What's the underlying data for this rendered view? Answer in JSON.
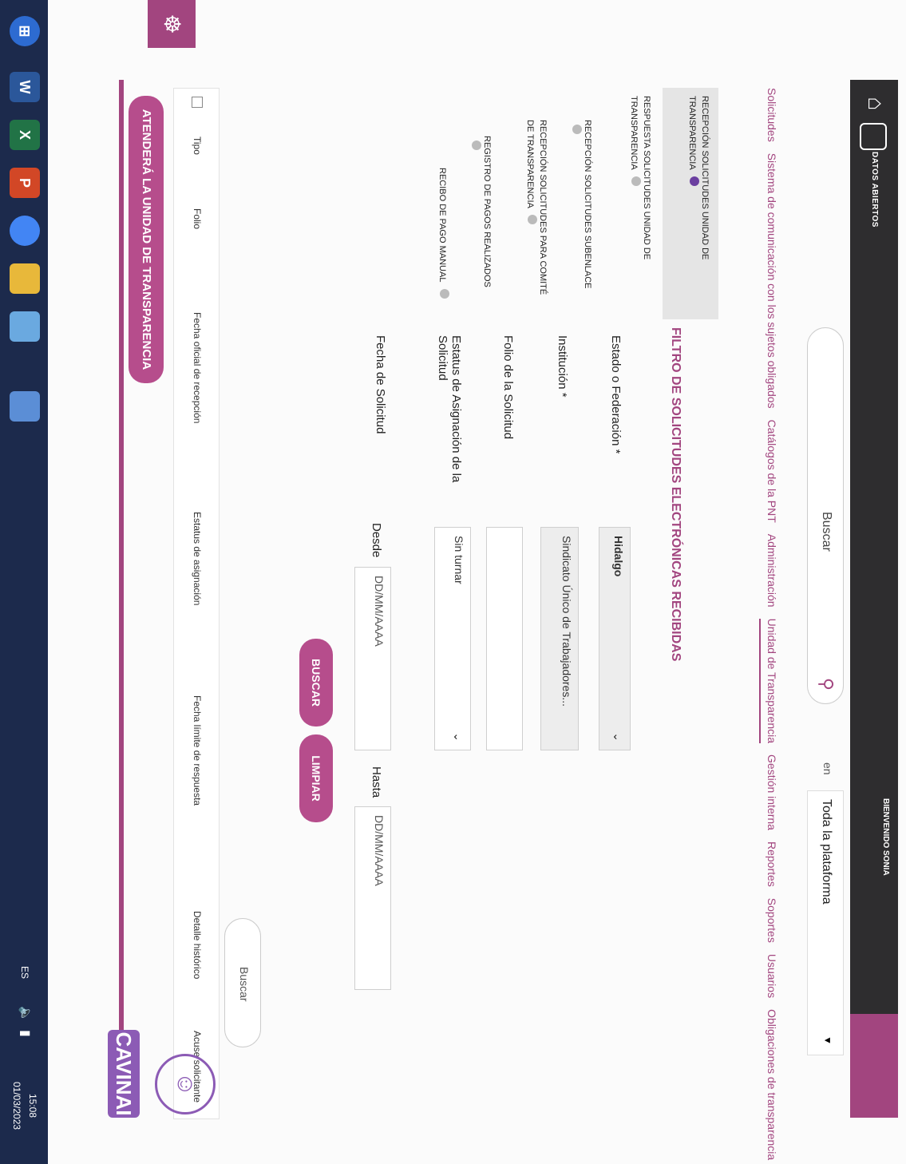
{
  "header": {
    "brand": "DATOS ABIERTOS",
    "search_placeholder": "Buscar",
    "search_in_label": "en",
    "scope_value": "Toda la plataforma",
    "welcome": "BIENVENIDO SONIA"
  },
  "nav": {
    "items": [
      {
        "label": "Solicitudes"
      },
      {
        "label": "Sistema de comunicación con los sujetos obligados"
      },
      {
        "label": "Catálogos de la PNT"
      },
      {
        "label": "Administración"
      },
      {
        "label": "Unidad de Transparencia"
      },
      {
        "label": "Gestión interna"
      },
      {
        "label": "Reportes"
      },
      {
        "label": "Soportes"
      },
      {
        "label": "Usuarios"
      },
      {
        "label": "Obligaciones de transparencia"
      }
    ]
  },
  "sidebar": {
    "items": [
      {
        "label": "RECEPCIÓN SOLICITUDES UNIDAD DE TRANSPARENCIA"
      },
      {
        "label": "RESPUESTA SOLICITUDES UNIDAD DE TRANSPARENCIA"
      },
      {
        "label": "RECEPCIÓN SOLICITUDES SUBENLACE"
      },
      {
        "label": "RECEPCIÓN SOLICITUDES PARA COMITÉ DE TRANSPARENCIA"
      },
      {
        "label": "REGISTRO DE PAGOS REALIZADOS"
      },
      {
        "label": "RECIBO DE PAGO MANUAL"
      }
    ]
  },
  "filter": {
    "title": "FILTRO DE SOLICITUDES ELECTRÓNICAS RECIBIDAS",
    "estado_label": "Estado o Federación *",
    "estado_value": "Hidalgo",
    "institucion_label": "Institución *",
    "institucion_value": "Sindicato Único de Trabajadores...",
    "folio_label": "Folio de la Solicitud",
    "folio_value": "",
    "estatus_label": "Estatus de Asignación de la Solicitud",
    "estatus_value": "Sin turnar",
    "fecha_label": "Fecha de Solicitud",
    "desde_label": "Desde",
    "desde_placeholder": "DD/MM/AAAA",
    "hasta_label": "Hasta",
    "hasta_placeholder": "DD/MM/AAAA",
    "buscar_btn": "BUSCAR",
    "limpiar_btn": "LIMPIAR"
  },
  "table": {
    "search_placeholder": "Buscar",
    "columns": [
      "Tipo",
      "Folio",
      "Fecha oficial de recepción",
      "Estatus de asignación",
      "Fecha límite de respuesta",
      "Detalle histórico",
      "Acuse solicitante"
    ]
  },
  "footer": {
    "attend_btn": "ATENDERÁ LA UNIDAD DE TRANSPARENCIA",
    "cavinai": "CAVINAI"
  },
  "taskbar": {
    "lang": "ES",
    "time": "15:08",
    "date": "01/03/2023",
    "apps": [
      {
        "icon": "word-icon",
        "letter": "W",
        "color": "#2b579a"
      },
      {
        "icon": "excel-icon",
        "letter": "X",
        "color": "#217346"
      },
      {
        "icon": "powerpoint-icon",
        "letter": "P",
        "color": "#d24726"
      },
      {
        "icon": "chrome-icon",
        "letter": "",
        "color": "#4285f4"
      },
      {
        "icon": "notes-icon",
        "letter": "",
        "color": "#e8b83a"
      },
      {
        "icon": "paint-icon",
        "letter": "",
        "color": "#6aa9e0"
      },
      {
        "icon": "calculator-icon",
        "letter": "",
        "color": "#5b8ed6"
      }
    ]
  }
}
